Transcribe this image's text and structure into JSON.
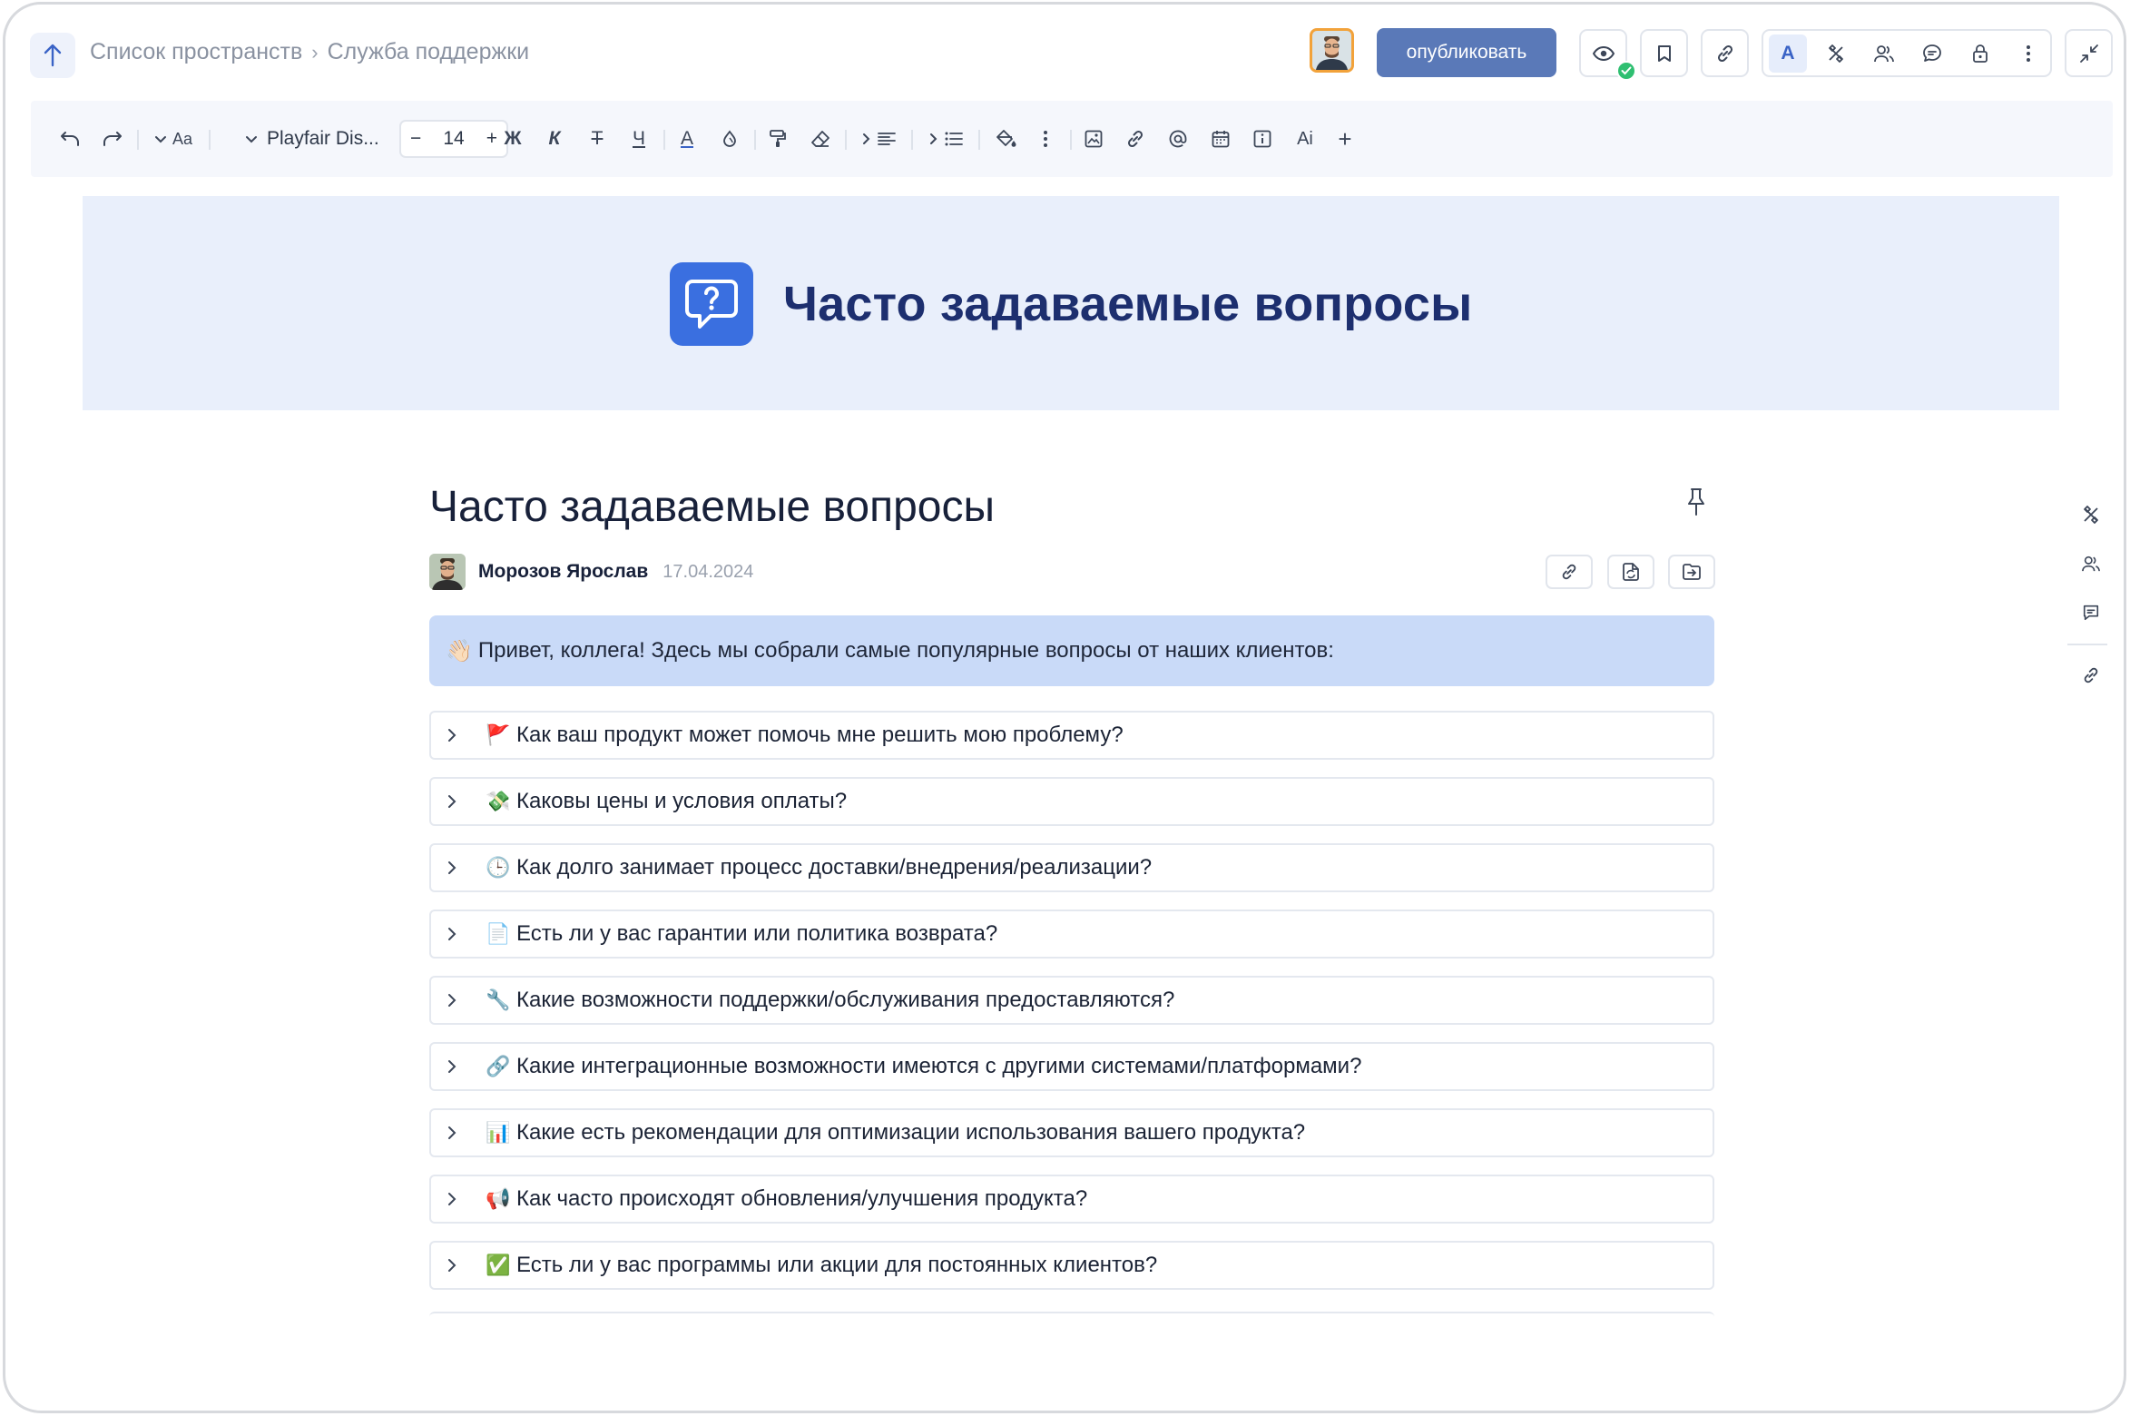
{
  "breadcrumb": {
    "items": [
      "Список пространств",
      "Служба поддержки"
    ],
    "separator": "›"
  },
  "header": {
    "publish_label": "опубликовать",
    "active_tool_label": "A"
  },
  "toolbar": {
    "font_family": "Playfair Dis...",
    "font_size": "14",
    "text_style_label": "Aa",
    "bold": "Ж",
    "italic": "К",
    "strike": "Т",
    "underline": "Ч",
    "color_label": "A",
    "ai_label": "Ai",
    "add_label": "+",
    "minus_label": "−",
    "plus_label": "+"
  },
  "cover": {
    "title": "Часто задаваемые вопросы",
    "icon": "question-bubble-icon"
  },
  "document": {
    "title": "Часто задаваемые вопросы",
    "author": "Морозов Ярослав",
    "date": "17.04.2024",
    "callout_emoji": "👋🏻",
    "callout_text": "Привет, коллега! Здесь мы собрали самые популярные вопросы от наших клиентов:"
  },
  "faq": [
    {
      "emoji": "🚩",
      "text": "Как ваш продукт может помочь мне решить мою проблему?"
    },
    {
      "emoji": "💸",
      "text": "Каковы цены и условия оплаты?"
    },
    {
      "emoji": "🕒",
      "text": "Как долго занимает процесс доставки/внедрения/реализации?"
    },
    {
      "emoji": "📄",
      "text": "Есть ли у вас гарантии или политика возврата?"
    },
    {
      "emoji": "🔧",
      "text": "Какие возможности поддержки/обслуживания предоставляются?"
    },
    {
      "emoji": "🔗",
      "text": "Какие интеграционные возможности имеются с другими системами/платформами?"
    },
    {
      "emoji": "📊",
      "text": "Какие есть рекомендации для оптимизации использования вашего продукта?"
    },
    {
      "emoji": "📢",
      "text": "Как часто происходят обновления/улучшения продукта?"
    },
    {
      "emoji": "✅",
      "text": "Есть ли у вас программы или акции для постоянных клиентов?"
    }
  ],
  "colors": {
    "accent": "#3a6fe0",
    "publish": "#5a79b8",
    "callout_bg": "#c9daf8",
    "cover_bg": "#e9effb",
    "success": "#2fbf71"
  }
}
